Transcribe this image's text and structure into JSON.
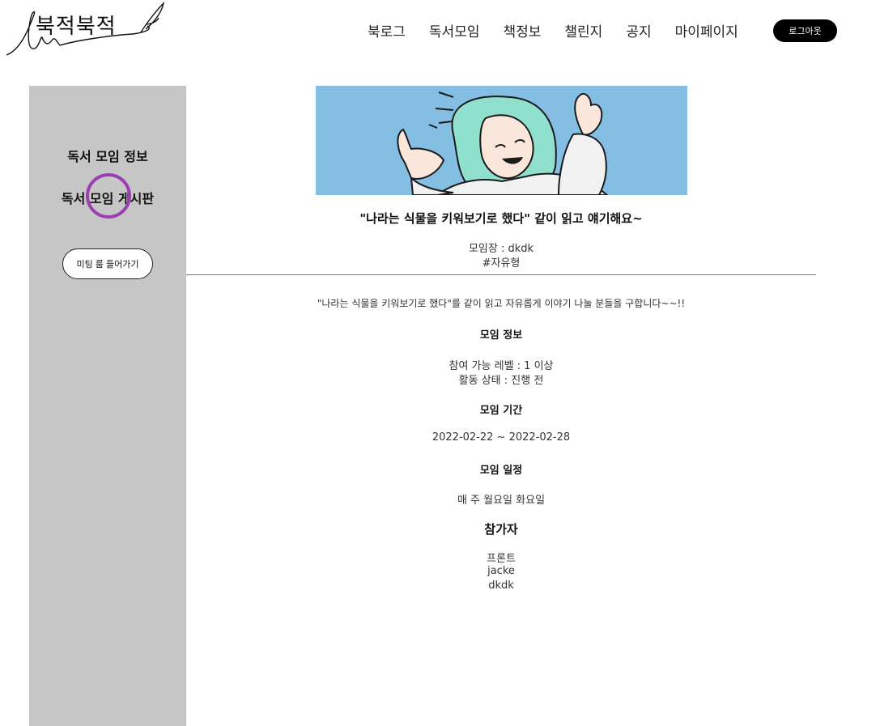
{
  "header": {
    "logo_text": "북적북적",
    "nav": [
      "북로그",
      "독서모임",
      "책정보",
      "챌린지",
      "공지",
      "마이페이지"
    ],
    "logout_label": "로그아웃"
  },
  "sidebar": {
    "info_link": "독서 모임 정보",
    "board_link": "독서 모임 게시판",
    "meeting_button": "미팅 룸 들어가기"
  },
  "meeting": {
    "title": "\"나라는 식물을 키워보기로 했다\" 같이 읽고 얘기해요~",
    "leader": "모임장 : dkdk",
    "tag": "#자유형",
    "description": "\"나라는 식물을 키워보기로 했다\"를 같이 읽고 자유롭게 이야기 나눌 분들을 구합니다~~!!",
    "info_heading": "모임 정보",
    "level": "참여 가능 레벨 : 1 이상",
    "status": "활동 상태 : 진행 전",
    "period_heading": "모임 기간",
    "period": "2022-02-22 ~ 2022-02-28",
    "schedule_heading": "모임 일정",
    "schedule": "매 주 월요일 화요일",
    "participants_heading": "참가자",
    "participants": [
      "프론트",
      "jacke",
      "dkdk"
    ]
  },
  "colors": {
    "sidebar_bg": "#c6c6c6",
    "banner_bg": "#84bfe3",
    "highlight": "#9b3fb0",
    "logout_bg": "#000000"
  }
}
